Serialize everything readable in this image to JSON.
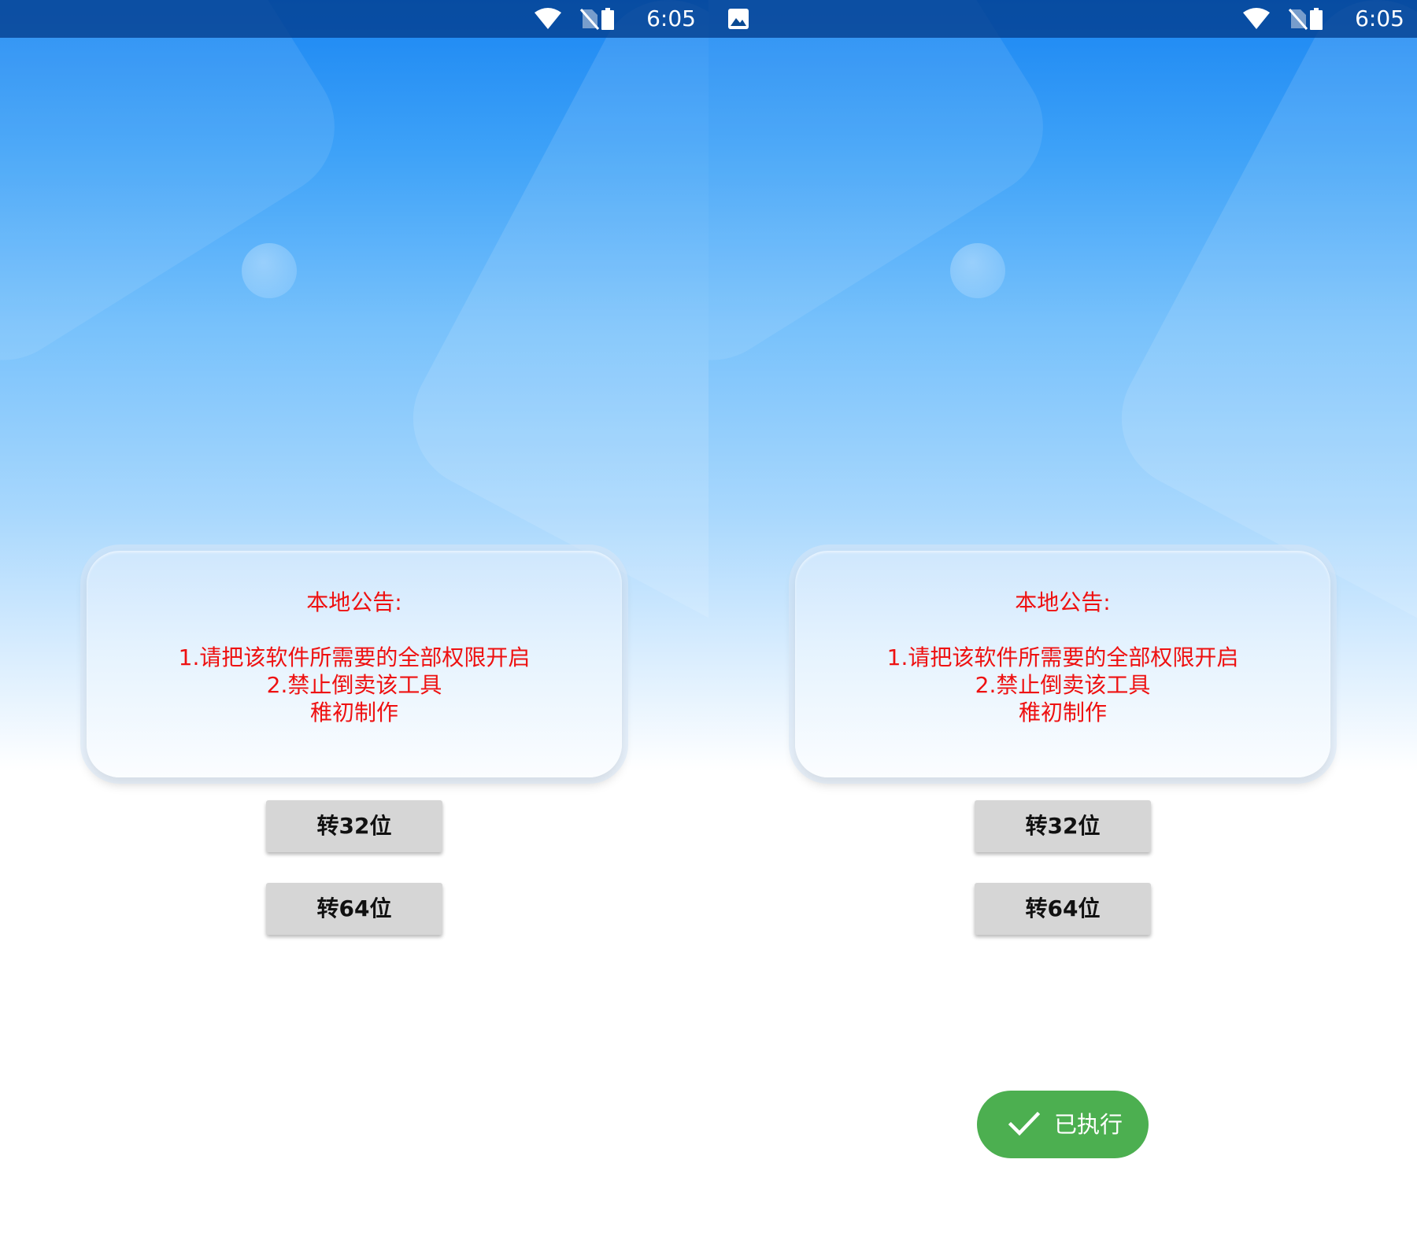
{
  "screens": [
    {
      "status_bar": {
        "time": "6:05",
        "icons": [
          "wifi-icon",
          "no-sim-icon",
          "battery-icon"
        ]
      },
      "notice": {
        "title": "本地公告:",
        "line1": "1.请把该软件所需要的全部权限开启",
        "line2": "2.禁止倒卖该工具",
        "line3": "稚初制作"
      },
      "buttons": {
        "convert32": "转32位",
        "convert64": "转64位"
      }
    },
    {
      "status_bar": {
        "time": "6:05",
        "icons": [
          "image-icon",
          "wifi-icon",
          "no-sim-icon",
          "battery-icon"
        ]
      },
      "notice": {
        "title": "本地公告:",
        "line1": "1.请把该软件所需要的全部权限开启",
        "line2": "2.禁止倒卖该工具",
        "line3": "稚初制作"
      },
      "buttons": {
        "convert32": "转32位",
        "convert64": "转64位"
      },
      "toast": {
        "text": "已执行",
        "icon": "check-icon"
      }
    }
  ],
  "colors": {
    "status_bar": "#0b4a93",
    "notice_text": "#ee1111",
    "button_bg": "#d6d6d6",
    "toast_bg": "#4caf50"
  }
}
